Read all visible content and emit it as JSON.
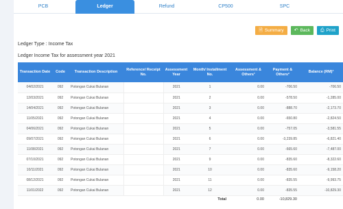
{
  "tabs": [
    {
      "label": "PCB",
      "active": false
    },
    {
      "label": "Ledger",
      "active": true
    },
    {
      "label": "Refund",
      "active": false
    },
    {
      "label": "CP500",
      "active": false
    },
    {
      "label": "SPC",
      "active": false
    }
  ],
  "buttons": {
    "summary": "Summary",
    "back": "Back",
    "print": "Print"
  },
  "ledger_type": "Ledger Type : Income Tax",
  "subtitle": "Ledger Income Tax for assessment year 2021",
  "columns": [
    "Transaction Date",
    "Code",
    "Transaction Description",
    "Reference/ Receipt No.",
    "Assessment Year",
    "Month/ Installment No.",
    "Assessment & Others¹",
    "Payment & Others²",
    "Balance (RM)³"
  ],
  "rows": [
    {
      "date": "04/02/2021",
      "code": "092",
      "desc": "Potongan Cukai Bulanan",
      "ref": "",
      "year": "2021",
      "month": "1",
      "assessment": "0.00",
      "payment": "-706.50",
      "balance": "-706.50"
    },
    {
      "date": "12/03/2021",
      "code": "092",
      "desc": "Potongan Cukai Bulanan",
      "ref": "",
      "year": "2021",
      "month": "2",
      "assessment": "0.00",
      "payment": "-578.50",
      "balance": "-1,285.00"
    },
    {
      "date": "14/04/2021",
      "code": "092",
      "desc": "Potongan Cukai Bulanan",
      "ref": "",
      "year": "2021",
      "month": "3",
      "assessment": "0.00",
      "payment": "-888.70",
      "balance": "-2,173.70"
    },
    {
      "date": "11/05/2021",
      "code": "092",
      "desc": "Potongan Cukai Bulanan",
      "ref": "",
      "year": "2021",
      "month": "4",
      "assessment": "0.00",
      "payment": "-650.80",
      "balance": "-2,824.50"
    },
    {
      "date": "04/06/2021",
      "code": "092",
      "desc": "Potongan Cukai Bulanan",
      "ref": "",
      "year": "2021",
      "month": "5",
      "assessment": "0.00",
      "payment": "-757.05",
      "balance": "-3,581.55"
    },
    {
      "date": "09/07/2021",
      "code": "092",
      "desc": "Potongan Cukai Bulanan",
      "ref": "",
      "year": "2021",
      "month": "6",
      "assessment": "0.00",
      "payment": "-3,239.85",
      "balance": "-6,821.40"
    },
    {
      "date": "11/08/2021",
      "code": "092",
      "desc": "Potongan Cukai Bulanan",
      "ref": "",
      "year": "2021",
      "month": "7",
      "assessment": "0.00",
      "payment": "-665.60",
      "balance": "-7,487.00"
    },
    {
      "date": "07/10/2021",
      "code": "092",
      "desc": "Potongan Cukai Bulanan",
      "ref": "",
      "year": "2021",
      "month": "9",
      "assessment": "0.00",
      "payment": "-835.60",
      "balance": "-8,322.60"
    },
    {
      "date": "10/11/2021",
      "code": "092",
      "desc": "Potongan Cukai Bulanan",
      "ref": "",
      "year": "2021",
      "month": "10",
      "assessment": "0.00",
      "payment": "-835.60",
      "balance": "-9,158.20"
    },
    {
      "date": "08/12/2021",
      "code": "092",
      "desc": "Potongan Cukai Bulanan",
      "ref": "",
      "year": "2021",
      "month": "11",
      "assessment": "0.00",
      "payment": "-835.55",
      "balance": "-9,993.75"
    },
    {
      "date": "11/01/2022",
      "code": "092",
      "desc": "Potongan Cukai Bulanan",
      "ref": "",
      "year": "2021",
      "month": "12",
      "assessment": "0.00",
      "payment": "-835.55",
      "balance": "-10,829.30"
    }
  ],
  "total": {
    "label": "Total",
    "assessment": "0.00",
    "payment": "-10,829.30"
  },
  "colors": {
    "accent": "#3a86dc",
    "summary": "#f4ad44",
    "back": "#5cb85c",
    "print": "#1fa2c9"
  },
  "icons": {
    "summary": "file-icon",
    "back": "back-arrow-icon",
    "print": "printer-icon"
  }
}
